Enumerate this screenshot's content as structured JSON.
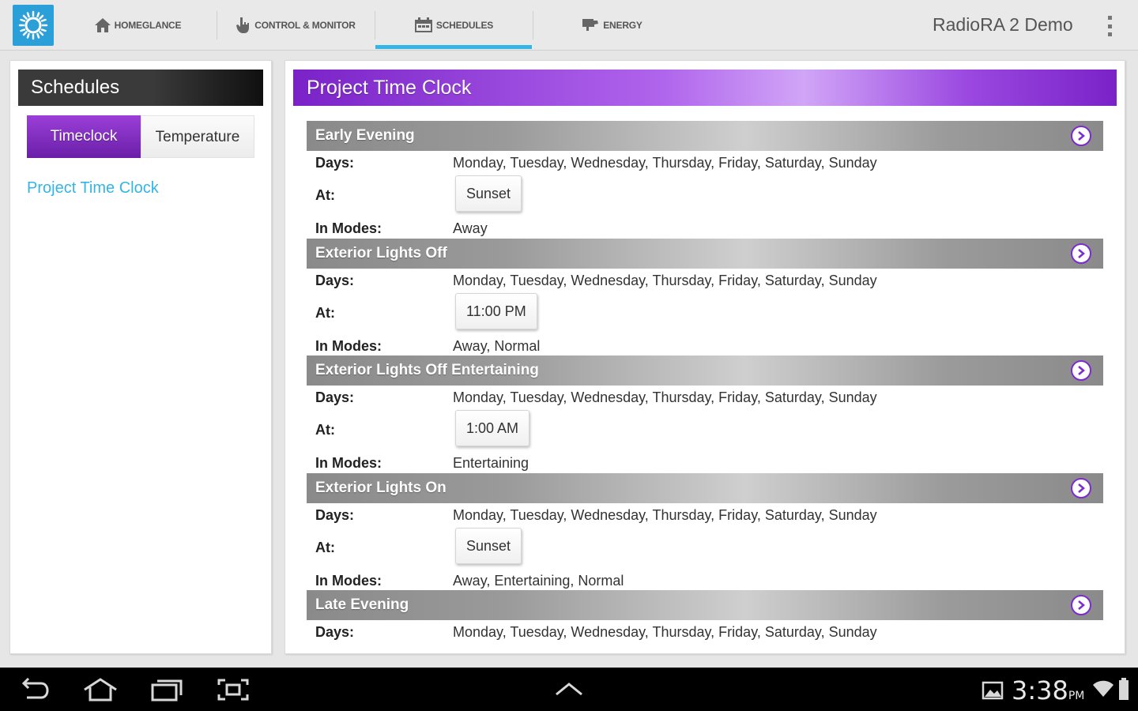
{
  "actionbar": {
    "app_icon": "sun-logo-icon",
    "tabs": [
      {
        "label": "HOMEGLANCE",
        "icon": "home-icon",
        "active": false
      },
      {
        "label": "CONTROL & MONITOR",
        "icon": "hand-pointer-icon",
        "active": false
      },
      {
        "label": "SCHEDULES",
        "icon": "calendar-icon",
        "active": true
      },
      {
        "label": "ENERGY",
        "icon": "energy-icon",
        "active": false
      }
    ],
    "title": "RadioRA 2 Demo",
    "menu_icon": "overflow-menu-icon"
  },
  "sidebar": {
    "title": "Schedules",
    "segments": [
      {
        "label": "Timeclock",
        "selected": true
      },
      {
        "label": "Temperature",
        "selected": false
      }
    ],
    "items": [
      {
        "label": "Project Time Clock"
      }
    ]
  },
  "main": {
    "title": "Project Time Clock",
    "labels": {
      "days": "Days:",
      "at": "At:",
      "modes": "In Modes:"
    },
    "events": [
      {
        "name": "Early Evening",
        "days": "Monday, Tuesday, Wednesday, Thursday, Friday, Saturday, Sunday",
        "at": "Sunset",
        "modes": "Away"
      },
      {
        "name": "Exterior Lights Off",
        "days": "Monday, Tuesday, Wednesday, Thursday, Friday, Saturday, Sunday",
        "at": "11:00 PM",
        "modes": "Away, Normal"
      },
      {
        "name": "Exterior Lights Off Entertaining",
        "days": "Monday, Tuesday, Wednesday, Thursday, Friday, Saturday, Sunday",
        "at": "1:00 AM",
        "modes": "Entertaining"
      },
      {
        "name": "Exterior Lights On",
        "days": "Monday, Tuesday, Wednesday, Thursday, Friday, Saturday, Sunday",
        "at": "Sunset",
        "modes": "Away, Entertaining, Normal"
      },
      {
        "name": "Late Evening",
        "days": "Monday, Tuesday, Wednesday, Thursday, Friday, Saturday, Sunday"
      }
    ]
  },
  "systembar": {
    "time": "3:38",
    "ampm": "PM",
    "icons": [
      "back-icon",
      "home-icon",
      "recent-apps-icon",
      "screenshot-icon",
      "up-chevron-icon",
      "gallery-notification-icon",
      "wifi-icon",
      "battery-icon"
    ]
  },
  "colors": {
    "accent": "#33b5e5",
    "purple": "#7a22c8",
    "section_bar": "#9a9a9a"
  }
}
